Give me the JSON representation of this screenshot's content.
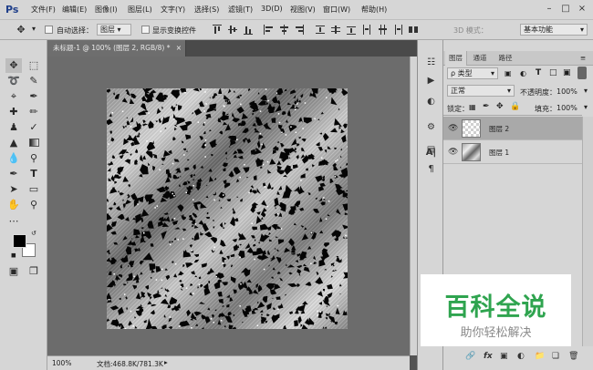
{
  "app": {
    "logo": "Ps"
  },
  "menu": [
    "文件(F)",
    "编辑(E)",
    "图像(I)",
    "图层(L)",
    "文字(Y)",
    "选择(S)",
    "滤镜(T)",
    "3D(D)",
    "视图(V)",
    "窗口(W)",
    "帮助(H)"
  ],
  "options": {
    "auto_select_label": "自动选择：",
    "auto_select_value": "图层",
    "show_transform_label": "显示变换控件",
    "mode_3d_label": "3D 模式：",
    "workspace": "基本功能"
  },
  "document": {
    "tab_title": "未标题-1 @ 100% (图层 2, RGB/8) *",
    "zoom": "100%",
    "doc_size": "文档:468.8K/781.3K"
  },
  "layers_panel": {
    "tabs": [
      "图层",
      "通道",
      "路径"
    ],
    "filter_kind": "ρ 类型",
    "blend_mode": "正常",
    "opacity_label": "不透明度：",
    "opacity_value": "100%",
    "lock_label": "锁定：",
    "fill_label": "填充：",
    "fill_value": "100%",
    "layers": [
      {
        "name": "图层 2",
        "selected": true
      },
      {
        "name": "图层 1",
        "selected": false
      }
    ]
  },
  "watermark": {
    "title": "百科全说",
    "subtitle": "助你轻松解决",
    "color": "#2fa44f"
  }
}
